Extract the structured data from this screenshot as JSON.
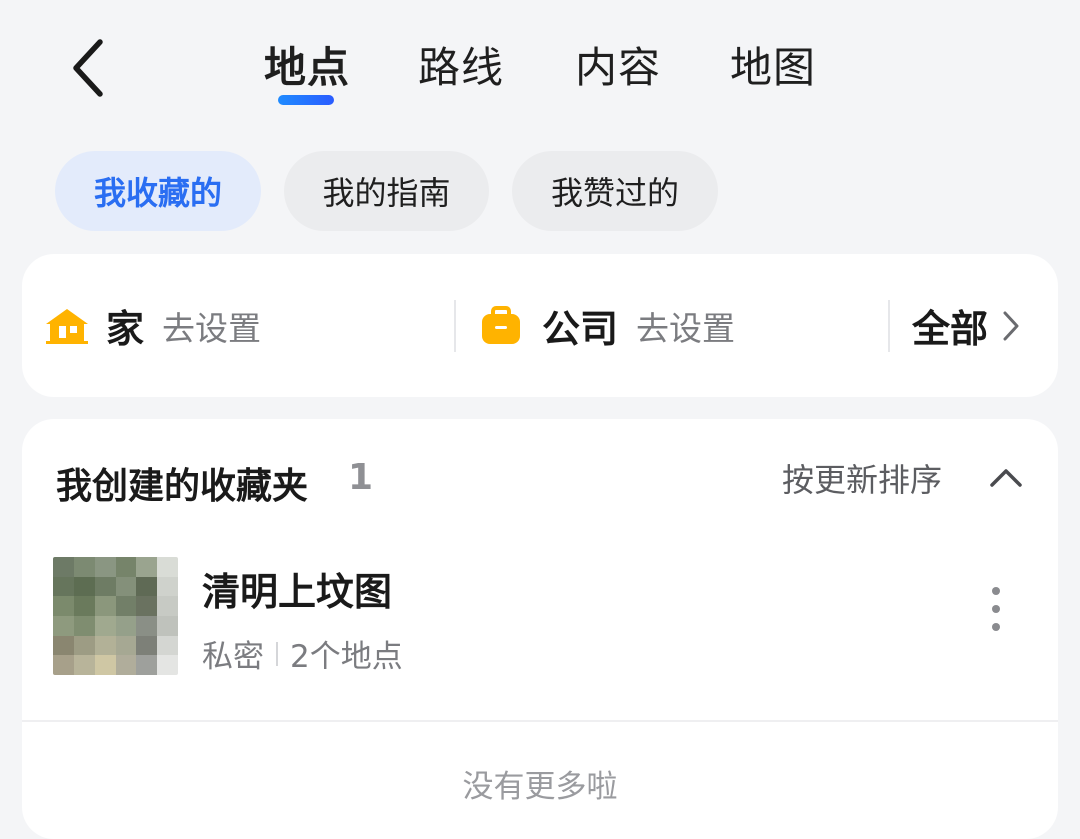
{
  "header": {
    "tabs": [
      {
        "label": "地点",
        "active": true
      },
      {
        "label": "路线",
        "active": false
      },
      {
        "label": "内容",
        "active": false
      },
      {
        "label": "地图",
        "active": false
      }
    ],
    "back_icon": "chevron-left-icon"
  },
  "filters": {
    "chips": [
      {
        "label": "我收藏的",
        "active": true
      },
      {
        "label": "我的指南",
        "active": false
      },
      {
        "label": "我赞过的",
        "active": false
      }
    ]
  },
  "quick_access": {
    "home": {
      "title": "家",
      "action": "去设置",
      "icon": "home-icon",
      "icon_color": "#ffb300"
    },
    "company": {
      "title": "公司",
      "action": "去设置",
      "icon": "briefcase-icon",
      "icon_color": "#ffb300"
    },
    "all": {
      "label": "全部",
      "icon": "chevron-right-icon"
    }
  },
  "favorites": {
    "title": "我创建的收藏夹",
    "count": "1",
    "sort_label": "按更新排序",
    "collapse_icon": "chevron-up-icon",
    "folders": [
      {
        "name": "清明上坟图",
        "privacy": "私密",
        "places": "2个地点",
        "more_icon": "more-vertical-icon"
      }
    ],
    "end_text": "没有更多啦"
  },
  "colors": {
    "accent": "#2a6ef2",
    "indicator": "#1f8bff",
    "background": "#f4f5f7",
    "card": "#ffffff",
    "icon_yellow": "#ffb300"
  }
}
